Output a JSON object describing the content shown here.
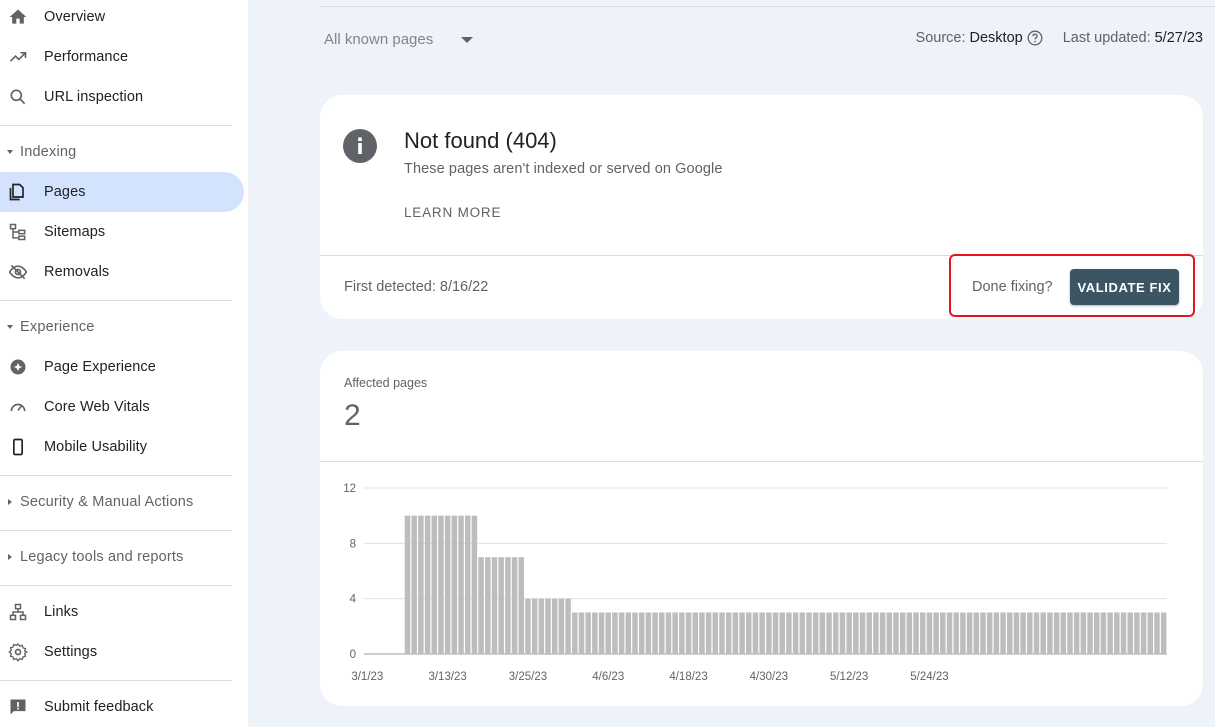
{
  "sidebar": {
    "overview": "Overview",
    "performance": "Performance",
    "url_inspection": "URL inspection",
    "indexing_header": "Indexing",
    "pages": "Pages",
    "sitemaps": "Sitemaps",
    "removals": "Removals",
    "experience_header": "Experience",
    "page_experience": "Page Experience",
    "core_web_vitals": "Core Web Vitals",
    "mobile_usability": "Mobile Usability",
    "security_header": "Security & Manual Actions",
    "legacy_header": "Legacy tools and reports",
    "links": "Links",
    "settings": "Settings",
    "submit_feedback": "Submit feedback"
  },
  "toolbar": {
    "filter_value": "All known pages",
    "source_label": "Source:",
    "source_value": "Desktop",
    "updated_label": "Last updated:",
    "updated_value": "5/27/23"
  },
  "issue": {
    "title": "Not found (404)",
    "subtitle": "These pages aren't indexed or served on Google",
    "learn_more": "LEARN MORE",
    "first_detected": "First detected: 8/16/22",
    "done_fixing": "Done fixing?",
    "validate_fix": "VALIDATE FIX"
  },
  "affected": {
    "label": "Affected pages",
    "value": "2"
  },
  "colors": {
    "accent_active": "#d3e3fd",
    "validate_button": "#3c5563",
    "highlight": "#e8141b",
    "bar": "#bdbdbd"
  },
  "chart_data": {
    "type": "bar",
    "ylim": [
      0,
      12
    ],
    "yticks": [
      "0",
      "4",
      "8",
      "12"
    ],
    "xticks": [
      "3/1/23",
      "3/13/23",
      "3/25/23",
      "4/6/23",
      "4/18/23",
      "4/30/23",
      "5/12/23",
      "5/24/23"
    ],
    "grid": true,
    "series": [
      {
        "values": [
          0,
          0,
          0,
          0,
          0,
          0,
          10,
          10,
          10,
          10,
          10,
          10,
          10,
          10,
          10,
          10,
          10,
          7,
          7,
          7,
          7,
          7,
          7,
          7,
          4,
          4,
          4,
          4,
          4,
          4,
          4,
          3,
          3,
          3,
          3,
          3,
          3,
          3,
          3,
          3,
          3,
          3,
          3,
          3,
          3,
          3,
          3,
          3,
          3,
          3,
          3,
          3,
          3,
          3,
          3,
          3,
          3,
          3,
          3,
          3,
          3,
          3,
          3,
          3,
          3,
          3,
          3,
          3,
          3,
          3,
          3,
          3,
          3,
          3,
          3,
          3,
          3,
          3,
          3,
          3,
          3,
          3,
          3,
          3,
          3,
          3,
          3,
          3,
          3,
          3,
          3,
          3,
          3,
          3,
          3,
          3,
          3,
          3,
          3,
          3,
          3,
          3,
          3,
          3,
          3,
          3,
          3,
          3,
          3,
          3,
          3,
          3,
          3,
          3,
          3,
          3,
          3,
          3,
          3,
          3
        ]
      }
    ]
  }
}
